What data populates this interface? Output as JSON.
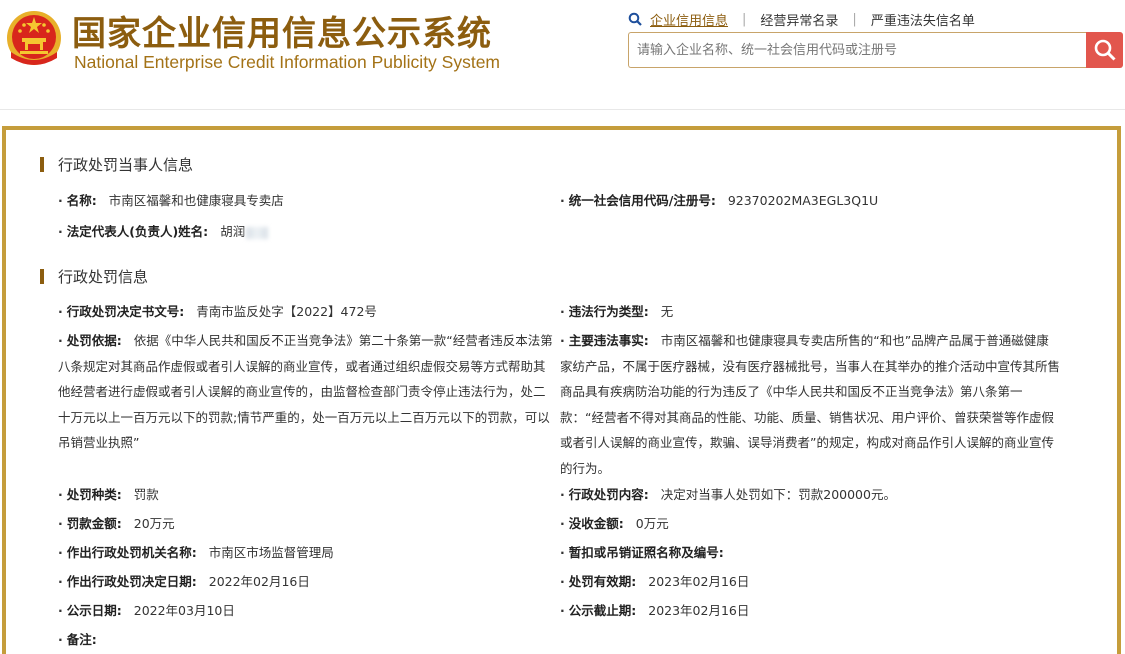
{
  "header": {
    "title_cn": "国家企业信用信息公示系统",
    "title_en": "National Enterprise Credit Information Publicity System",
    "nav": [
      "企业信用信息",
      "经营异常名录",
      "严重违法失信名单"
    ],
    "search_placeholder": "请输入企业名称、统一社会信用代码或注册号"
  },
  "party": {
    "section_title": "行政处罚当事人信息",
    "name_label": "名称:",
    "name_value": "市南区福馨和也健康寝具专卖店",
    "code_label": "统一社会信用代码/注册号:",
    "code_value": "92370202MA3EGL3Q1U",
    "rep_label": "法定代表人(负责人)姓名:",
    "rep_value": "胡润"
  },
  "penalty": {
    "section_title": "行政处罚信息",
    "doc_label": "行政处罚决定书文号:",
    "doc_value": "青南市监反处字【2022】472号",
    "type_label": "违法行为类型:",
    "type_value": "无",
    "basis_label": "处罚依据:",
    "basis_value": "依据《中华人民共和国反不正当竞争法》第二十条第一款“经营者违反本法第八条规定对其商品作虚假或者引人误解的商业宣传，或者通过组织虚假交易等方式帮助其他经营者进行虚假或者引人误解的商业宣传的，由监督检查部门责令停止违法行为，处二十万元以上一百万元以下的罚款;情节严重的，处一百万元以上二百万元以下的罚款，可以吊销营业执照”",
    "facts_label": "主要违法事实:",
    "facts_value": "市南区福馨和也健康寝具专卖店所售的“和也”品牌产品属于普通磁健康家纺产品，不属于医疗器械，没有医疗器械批号，当事人在其举办的推介活动中宣传其所售商品具有疾病防治功能的行为违反了《中华人民共和国反不正当竞争法》第八条第一款：“经营者不得对其商品的性能、功能、质量、销售状况、用户评价、曾获荣誉等作虚假或者引人误解的商业宣传，欺骗、误导消费者”的规定，构成对商品作引人误解的商业宣传的行为。",
    "kind_label": "处罚种类:",
    "kind_value": "罚款",
    "content_label": "行政处罚内容:",
    "content_value": "决定对当事人处罚如下：罚款200000元。",
    "amount_label": "罚款金额:",
    "amount_value": "20万元",
    "confiscate_label": "没收金额:",
    "confiscate_value": "0万元",
    "authority_label": "作出行政处罚机关名称:",
    "authority_value": "市南区市场监督管理局",
    "license_label": "暂扣或吊销证照名称及编号:",
    "license_value": "",
    "decision_date_label": "作出行政处罚决定日期:",
    "decision_date_value": "2022年02月16日",
    "validity_label": "处罚有效期:",
    "validity_value": "2023年02月16日",
    "publish_label": "公示日期:",
    "publish_value": "2022年03月10日",
    "deadline_label": "公示截止期:",
    "deadline_value": "2023年02月16日",
    "remark_label": "备注:",
    "remark_value": ""
  },
  "colors": {
    "brand": "#8c5d0f",
    "border": "#c59d3b",
    "search_button": "#e2564d"
  },
  "icons": [
    "national-emblem-icon",
    "search-icon"
  ]
}
